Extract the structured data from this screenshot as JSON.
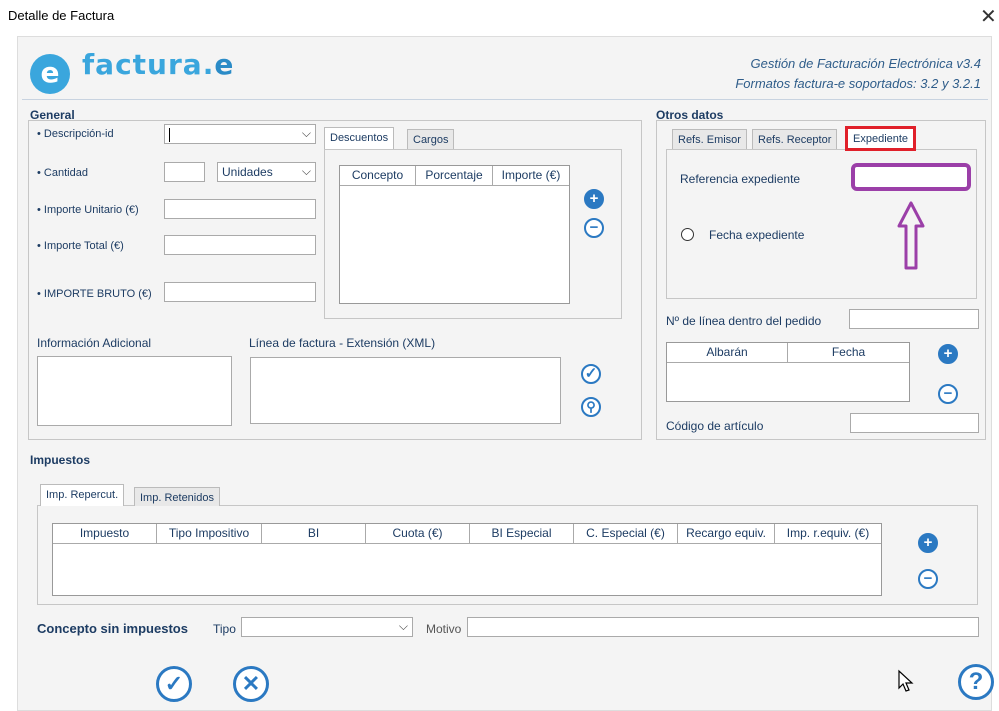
{
  "window": {
    "title": "Detalle de Factura",
    "close_glyph": "✕"
  },
  "header": {
    "logo_letter": "e",
    "logo_text_a": "factura.",
    "logo_text_b": "e",
    "line1": "Gestión de Facturación Electrónica v3.4",
    "line2": "Formatos factura-e soportados: 3.2 y 3.2.1"
  },
  "general": {
    "title": "General",
    "descripcion_label": "• Descripción-id",
    "cantidad_label": "• Cantidad",
    "unidades_value": "Unidades",
    "importe_unitario_label": "• Importe Unitario (€)",
    "importe_total_label": "• Importe Total (€)",
    "importe_bruto_label": "• IMPORTE BRUTO (€)",
    "info_adicional_label": "Información Adicional",
    "linea_ext_label": "Línea de factura - Extensión (XML)",
    "tabs": [
      "Descuentos",
      "Cargos"
    ],
    "descuentos_columns": [
      "Concepto",
      "Porcentaje",
      "Importe (€)"
    ]
  },
  "otros": {
    "title": "Otros datos",
    "tabs": [
      "Refs. Emisor",
      "Refs. Receptor",
      "Expediente"
    ],
    "ref_expediente_label": "Referencia expediente",
    "fecha_expediente_label": "Fecha expediente",
    "linea_pedido_label": "Nº de línea dentro del pedido",
    "albaran_columns": [
      "Albarán",
      "Fecha"
    ],
    "codigo_articulo_label": "Código de artículo"
  },
  "impuestos": {
    "title": "Impuestos",
    "tabs": [
      "Imp. Repercut.",
      "Imp. Retenidos"
    ],
    "columns": [
      "Impuesto",
      "Tipo Impositivo",
      "BI",
      "Cuota (€)",
      "BI Especial",
      "C. Especial (€)",
      "Recargo equiv.",
      "Imp. r.equiv. (€)"
    ]
  },
  "concepto": {
    "label": "Concepto sin impuestos",
    "tipo_label": "Tipo",
    "motivo_label": "Motivo"
  },
  "icons": {
    "plus": "+",
    "minus": "−",
    "check": "✓",
    "search": "⚲",
    "cancel": "✕",
    "help": "?",
    "arrow_up": "⇧"
  },
  "colors": {
    "accent": "#2b79c2",
    "highlight_red": "#e0202a",
    "annotation_purple": "#9b3fa8"
  }
}
